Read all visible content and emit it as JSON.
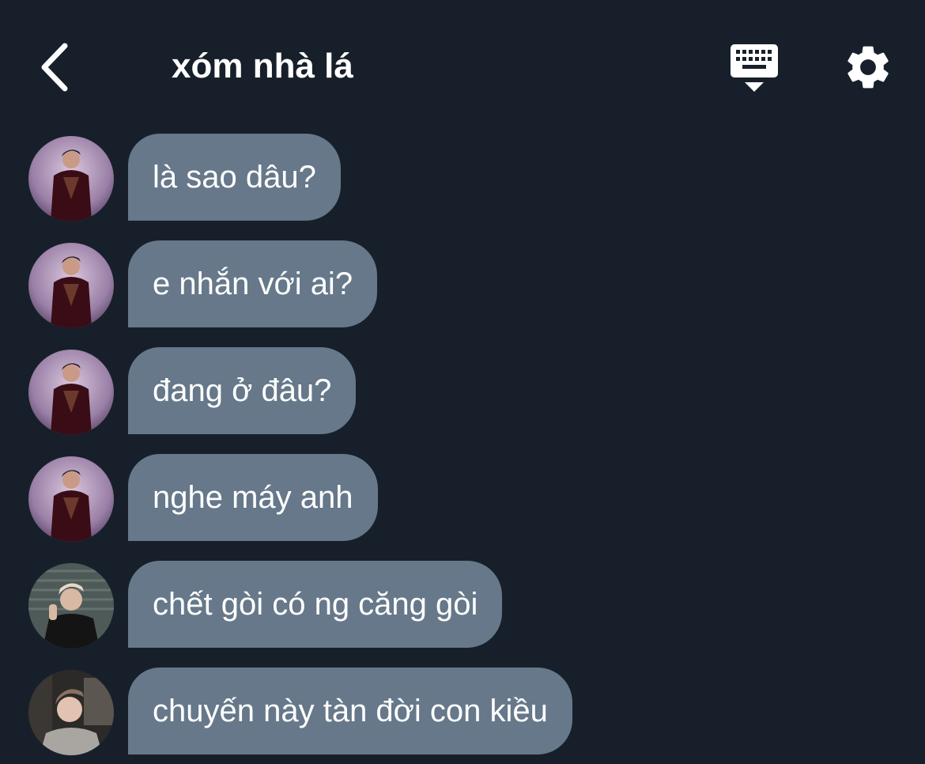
{
  "header": {
    "title": "xóm nhà lá",
    "back_icon": "chevron-left-icon",
    "keyboard_icon": "keyboard-hide-icon",
    "settings_icon": "gear-icon"
  },
  "messages": [
    {
      "text": "là sao dâu?",
      "avatar": "avatar-a"
    },
    {
      "text": "e nhắn với ai?",
      "avatar": "avatar-a"
    },
    {
      "text": "đang ở đâu?",
      "avatar": "avatar-a"
    },
    {
      "text": "nghe máy anh",
      "avatar": "avatar-a"
    },
    {
      "text": "chết gòi có ng căng gòi",
      "avatar": "avatar-b"
    },
    {
      "text": "chuyến này tàn đời con kiều",
      "avatar": "avatar-c"
    }
  ],
  "colors": {
    "background": "#17202a",
    "bubble": "#66788a",
    "text": "#ffffff"
  }
}
